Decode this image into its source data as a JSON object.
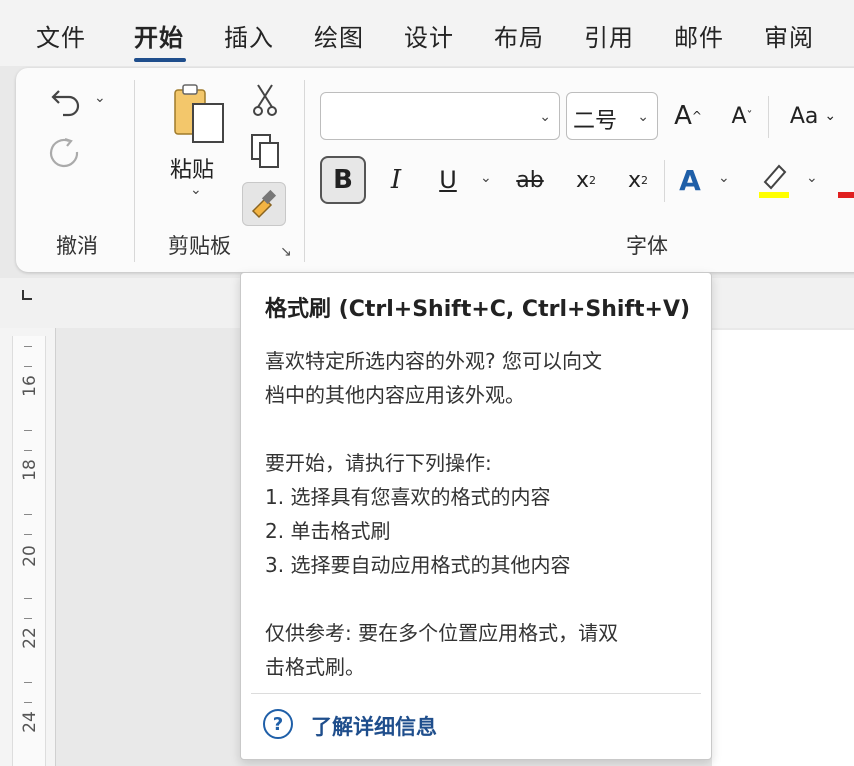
{
  "tabs": [
    {
      "label": "文件"
    },
    {
      "label": "开始"
    },
    {
      "label": "插入"
    },
    {
      "label": "绘图"
    },
    {
      "label": "设计"
    },
    {
      "label": "布局"
    },
    {
      "label": "引用"
    },
    {
      "label": "邮件"
    },
    {
      "label": "审阅"
    }
  ],
  "active_tab": "开始",
  "ribbon": {
    "undo_group_label": "撤消",
    "clipboard": {
      "paste_label": "粘贴",
      "group_label": "剪贴板"
    },
    "font": {
      "group_label": "字体",
      "font_name_value": "",
      "font_size_value": "二号",
      "grow_label": "A",
      "shrink_label": "A",
      "case_label": "Aa",
      "bold_label": "B",
      "italic_label": "I",
      "underline_label": "U",
      "strike_label": "ab",
      "subscript_label": "x",
      "superscript_label": "x",
      "text_effect_label": "A"
    }
  },
  "ruler": {
    "numbers": [
      "16",
      "18",
      "20",
      "22",
      "24"
    ]
  },
  "tooltip": {
    "title": "格式刷 (Ctrl+Shift+C, Ctrl+Shift+V)",
    "lines": [
      "喜欢特定所选内容的外观? 您可以向文",
      "档中的其他内容应用该外观。",
      "要开始，请执行下列操作:",
      "1. 选择具有您喜欢的格式的内容",
      "2. 单击格式刷",
      "3. 选择要自动应用格式的其他内容",
      "仅供参考: 要在多个位置应用格式，请双",
      "击格式刷。"
    ],
    "help_link": "了解详细信息"
  },
  "colors": {
    "accent": "#1f4e8c",
    "highlight": "#ffff00",
    "font_color": "#e02020",
    "text_effect": "#1f5fa8"
  }
}
